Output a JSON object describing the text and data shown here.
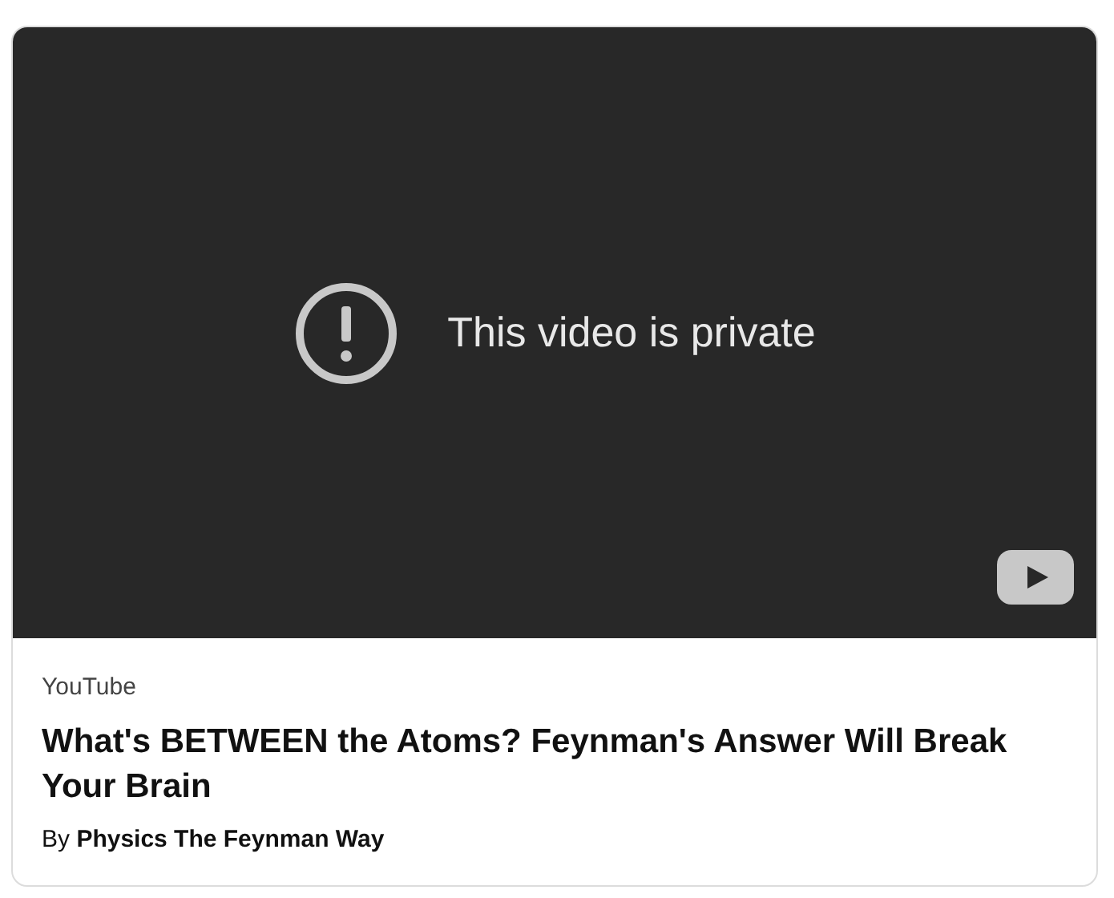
{
  "video": {
    "message": "This video is private"
  },
  "source": "YouTube",
  "title": "What's BETWEEN the Atoms? Feynman's Answer Will Break Your Brain",
  "byline": "By **Physics The Feynman Way**"
}
